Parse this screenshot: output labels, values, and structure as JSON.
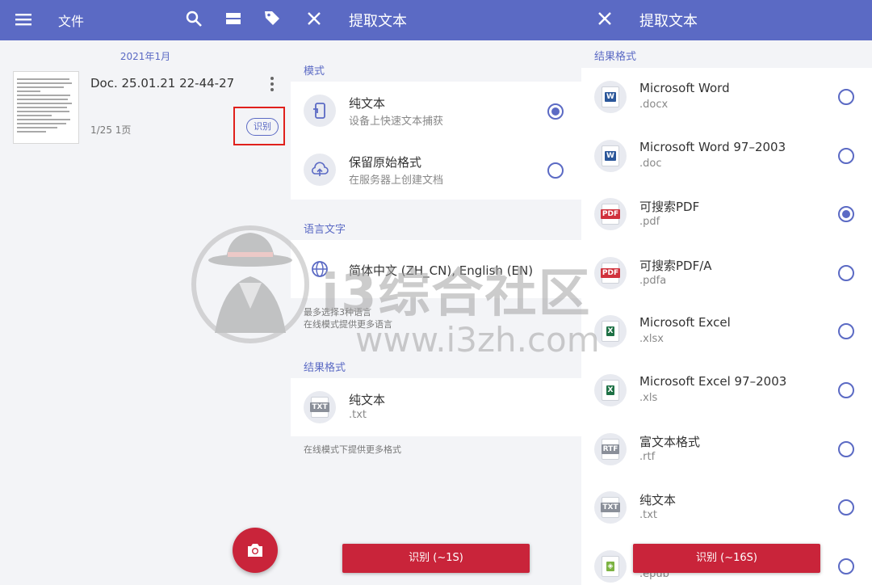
{
  "colors": {
    "primary": "#5b6ac4",
    "accent": "#c9243a",
    "highlight": "#e0201c"
  },
  "panel1": {
    "title": "文件",
    "date_header": "2021年1月",
    "doc": {
      "title": "Doc. 25.01.21 22-44-27",
      "meta": "1/25  1页",
      "recognize_chip": "识别"
    },
    "icons": [
      "menu-icon",
      "search-icon",
      "view-icon",
      "tag-icon",
      "more-icon",
      "camera-icon"
    ]
  },
  "panel2": {
    "title": "提取文本",
    "mode_header": "模式",
    "modes": [
      {
        "label": "纯文本",
        "sub": "设备上快速文本捕获",
        "selected": true,
        "icon": "phone-icon"
      },
      {
        "label": "保留原始格式",
        "sub": "在服务器上创建文档",
        "selected": false,
        "icon": "cloud-icon"
      }
    ],
    "lang_header": "语言文字",
    "language": "简体中文 (ZH_CN), English (EN)",
    "lang_note1": "最多选择3种语言",
    "lang_note2": "在线模式提供更多语言",
    "format_header": "结果格式",
    "format": {
      "label": "纯文本",
      "sub": ".txt"
    },
    "format_note": "在线模式下提供更多格式",
    "button": "识别 (~1S)"
  },
  "panel3": {
    "title": "提取文本",
    "format_header": "结果格式",
    "formats": [
      {
        "label": "Microsoft Word",
        "ext": ".docx",
        "icon": "W",
        "color": "#2b579a",
        "selected": false
      },
      {
        "label": "Microsoft Word 97–2003",
        "ext": ".doc",
        "icon": "W",
        "color": "#2b579a",
        "selected": false
      },
      {
        "label": "可搜索PDF",
        "ext": ".pdf",
        "icon": "PDF",
        "color": "#d0313c",
        "selected": true
      },
      {
        "label": "可搜索PDF/A",
        "ext": ".pdfa",
        "icon": "PDF",
        "color": "#d0313c",
        "selected": false
      },
      {
        "label": "Microsoft Excel",
        "ext": ".xlsx",
        "icon": "X",
        "color": "#1e7145",
        "selected": false
      },
      {
        "label": "Microsoft Excel 97–2003",
        "ext": ".xls",
        "icon": "X",
        "color": "#1e7145",
        "selected": false
      },
      {
        "label": "富文本格式",
        "ext": ".rtf",
        "icon": "RTF",
        "color": "#8a8f99",
        "selected": false
      },
      {
        "label": "纯文本",
        "ext": ".txt",
        "icon": "TXT",
        "color": "#8a8f99",
        "selected": false
      },
      {
        "label": "",
        "ext": ".epub",
        "icon": "◈",
        "color": "#7cb342",
        "selected": false
      }
    ],
    "button": "识别 (~16S)"
  },
  "watermark": {
    "text": "i3综合社区",
    "url": "www.i3zh.com"
  }
}
